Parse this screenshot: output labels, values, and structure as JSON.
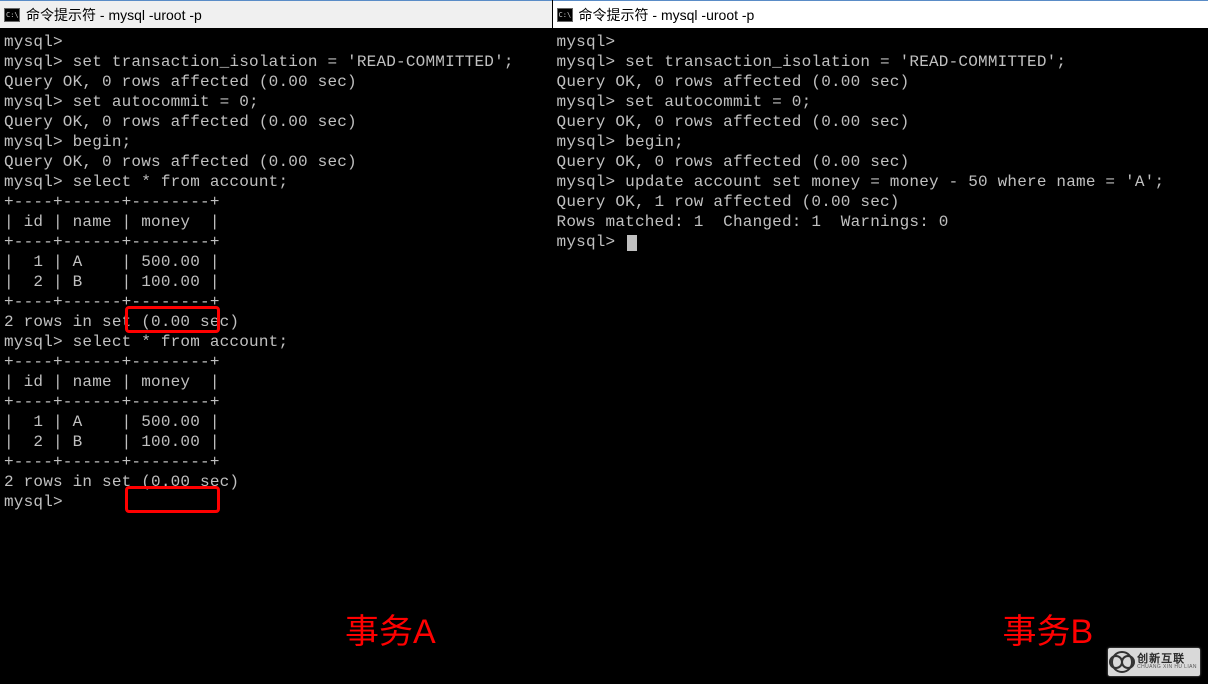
{
  "left": {
    "title": "命令提示符 - mysql  -uroot -p",
    "overlay_label": "事务A",
    "lines": [
      "mysql>",
      "mysql> set transaction_isolation = 'READ-COMMITTED';",
      "Query OK, 0 rows affected (0.00 sec)",
      "",
      "mysql> set autocommit = 0;",
      "Query OK, 0 rows affected (0.00 sec)",
      "",
      "mysql> begin;",
      "Query OK, 0 rows affected (0.00 sec)",
      "",
      "mysql> select * from account;",
      "+----+------+--------+",
      "| id | name | money  |",
      "+----+------+--------+",
      "|  1 | A    | 500.00 |",
      "|  2 | B    | 100.00 |",
      "+----+------+--------+",
      "2 rows in set (0.00 sec)",
      "",
      "mysql> select * from account;",
      "+----+------+--------+",
      "| id | name | money  |",
      "+----+------+--------+",
      "|  1 | A    | 500.00 |",
      "|  2 | B    | 100.00 |",
      "+----+------+--------+",
      "2 rows in set (0.00 sec)",
      "",
      "mysql>"
    ],
    "highlight": {
      "row1_value": "500.00",
      "row2_value": "500.00"
    }
  },
  "right": {
    "title": "命令提示符 - mysql  -uroot -p",
    "overlay_label": "事务B",
    "lines": [
      "mysql>",
      "mysql> set transaction_isolation = 'READ-COMMITTED';",
      "Query OK, 0 rows affected (0.00 sec)",
      "",
      "mysql> set autocommit = 0;",
      "Query OK, 0 rows affected (0.00 sec)",
      "",
      "mysql> begin;",
      "Query OK, 0 rows affected (0.00 sec)",
      "",
      "mysql> update account set money = money - 50 where name = 'A';",
      "Query OK, 1 row affected (0.00 sec)",
      "Rows matched: 1  Changed: 1  Warnings: 0",
      "",
      "mysql> "
    ]
  },
  "watermark": {
    "cn": "创新互联",
    "py": "CHUANG XIN HU LIAN"
  }
}
